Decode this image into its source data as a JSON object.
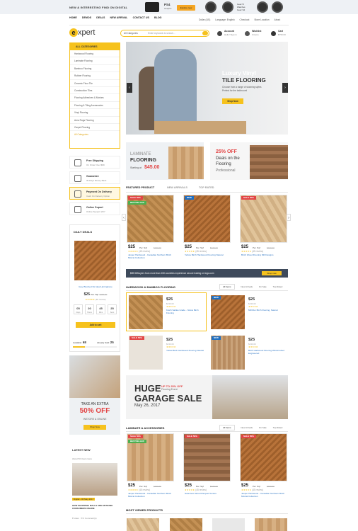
{
  "topbar": {
    "promo": "NEW & INTERESTING FIND ON DIGITAL",
    "ps4_title": "PS4",
    "ps4_sub": "Graphic",
    "explore": "Explore now",
    "gear_line1": "Gear 5/",
    "gear_line2": "Watches",
    "gear_line3": "Gear S2"
  },
  "nav": {
    "items": [
      "HOME",
      "DEMOS",
      "DEALS",
      "NEW ARRIVAL",
      "CONTACT US",
      "BLOG"
    ],
    "right": [
      "Dollar (US)",
      "Language: English",
      "Checkout",
      "Store Location",
      "About"
    ]
  },
  "header": {
    "logo_letter": "e",
    "logo_rest": "xpert",
    "search_category": "All Categories",
    "search_placeholder": "Enter keywords to search...",
    "account": "Account",
    "account_sub": "Hello! Sign in",
    "wishlist": "Wishlist",
    "wishlist_sub": "0 items",
    "cart": "Cart",
    "cart_sub": "$750.00"
  },
  "categories": {
    "head": "ALL CATEGORIES",
    "items": [
      "Hardwood Flooring",
      "Laminate Flooring",
      "Bamboo Flooring",
      "Rubber Flooring",
      "Ceramic Floor Tile",
      "Construction Tiles",
      "Flooring Adhesives & Mortars",
      "Flooring & Tiling Accessories",
      "Vinyl Flooring",
      "Area Rugs Flooring",
      "Carpet Flooring"
    ],
    "more": "All Categories"
  },
  "hero": {
    "line1": "Luxury Vinyl",
    "line2": "TILE FLOORING",
    "line3": "Choose from a range of stunning styles",
    "line4": "Perfect for the bathroom!",
    "button": "Shop Now"
  },
  "banners": {
    "b1_a": "LAMINATE",
    "b1_b": "FLOORING",
    "b1_c": "Starting at",
    "b1_price": "$45.00",
    "b2_a": "25% OFF",
    "b2_b": "Deals on the",
    "b2_c": "Flooring",
    "b2_d": "Professional"
  },
  "features": [
    {
      "t": "Free Shipping",
      "s": "On Order Over $99"
    },
    {
      "t": "Guarantee",
      "s": "30 Days Money Back"
    },
    {
      "t": "Payment On Delivery",
      "s": "Cash On Delivery Option"
    },
    {
      "t": "Online Suport",
      "s": "Online Support 24/7"
    }
  ],
  "featured_tabs": [
    "FEATURED PRODUCT",
    "NEW ARRIVALS",
    "TOP RATED"
  ],
  "featured": [
    {
      "badges": [
        "SALE 50%",
        "BESTSELLER"
      ],
      "price": "$25",
      "cents": "99",
      "per": "Per. Sqf",
      "old": "$230.00",
      "reviews": "(45 review)",
      "name": "Jasper Hardwood - Canadian Northern Birch Mistral Collection"
    },
    {
      "badges": [
        "NEW"
      ],
      "price": "$25",
      "cents": "99",
      "per": "Per. Sqf",
      "old": "$230.00",
      "reviews": "(45 review)",
      "name": "Yellow Birch Hardwood Flooring Natural"
    },
    {
      "badges": [
        "SALE 50%"
      ],
      "price": "$25",
      "cents": "99",
      "per": "Per. Sqf",
      "old": "$230.00",
      "reviews": "(45 review)",
      "name": "Birch Wood Flooring Mill Designs"
    }
  ],
  "promo_bar": {
    "text": "$89.55/buyers from more than 150 countries experience secure trading on logo.com",
    "button": "Shop now"
  },
  "hardwood": {
    "title": "HARDWOOD & BAMBOO FLOORING",
    "tabs": [
      "All Items",
      "New Arrivals",
      "On Sale",
      "Top Rated"
    ],
    "items": [
      {
        "price": "$25",
        "cents": "99",
        "per": "Per. Sqf",
        "old": "$230.00",
        "name": "Kutch Sables Grade - Yellow Birch Flooring",
        "badge": ""
      },
      {
        "price": "$25",
        "cents": "99",
        "per": "Per. Sqf",
        "old": "$230.00",
        "name": "Mill Run Birch Flooring, Natural",
        "badge": "NEW"
      },
      {
        "price": "$25",
        "cents": "99",
        "per": "Per. Sqf",
        "old": "$230.00",
        "name": "Yellow Birch Hardwood Flooring Natural",
        "badge": "SALE 50%"
      },
      {
        "price": "$25",
        "cents": "99",
        "per": "Per. Sqf",
        "old": "$230.00",
        "name": "Birch Hardwood Flooring Wirebrushed Engineered",
        "badge": "NEW"
      }
    ]
  },
  "garage": {
    "huge": "HUGE",
    "off": "UP TO 25% OFF",
    "event": "Flooring Event",
    "sale": "GARAGE SALE",
    "date": "May 26, 2017"
  },
  "laminate": {
    "title": "LAMINATE & ACCESSORIES",
    "tabs": [
      "All Items",
      "New Arrivals",
      "On Sale",
      "Top Rated"
    ],
    "items": [
      {
        "badges": [
          "SALE 50%",
          "BESTSELLER"
        ],
        "price": "$25",
        "cents": "99",
        "per": "Per. Sqf",
        "old": "$230.00",
        "reviews": "(45 review)",
        "name": "Jasper Hardwood - Canadian Northern Birch Mistral Collection"
      },
      {
        "badges": [
          "SALE 50%"
        ],
        "price": "$25",
        "cents": "99",
        "per": "Per. Sqf",
        "old": "$230.00",
        "reviews": "(45 review)",
        "name": "Seamless Wood Parquet Texture"
      },
      {
        "badges": [
          "SALE 50%"
        ],
        "price": "$25",
        "cents": "99",
        "per": "Per. Sqf",
        "old": "$230.00",
        "reviews": "(45 review)",
        "name": "Jasper Hardwood - Canadian Northern Birch Mistral Collection"
      }
    ]
  },
  "most_viewed": "MOST VIEWED PRODUCTS",
  "deals": {
    "title": "DAILY DEALS",
    "name": "Grey Brushed Uk Ideal Herringbone",
    "price": "$25",
    "cents": "99",
    "per": "Per. Sqf",
    "old": "$230.00",
    "reviews": "(45 review)",
    "countdown": [
      {
        "v": "05",
        "l": "Days"
      },
      {
        "v": "20",
        "l": "Hours"
      },
      {
        "v": "45",
        "l": "Mins"
      },
      {
        "v": "25",
        "l": "Secs"
      }
    ],
    "add": "Add to cart",
    "available_label": "Available:",
    "available": "68",
    "sold_label": "Already Sold:",
    "sold": "25",
    "sold_fraction": 0.27
  },
  "side_promo": {
    "a": "TAKE AN EXTRA",
    "b": "50% OFF",
    "c": "INSTORE & ONLINE",
    "d": "Shop Now"
  },
  "latest": {
    "title": "LATEST NEW",
    "about": "About 50 Users Here",
    "tag": "Digital - 06 May 2017",
    "text": "HOW SHOPPING MALLS ARE ENTICING CONSUMERS ONLINE",
    "likes": "Likes",
    "comments": "0 Comment(s)"
  }
}
